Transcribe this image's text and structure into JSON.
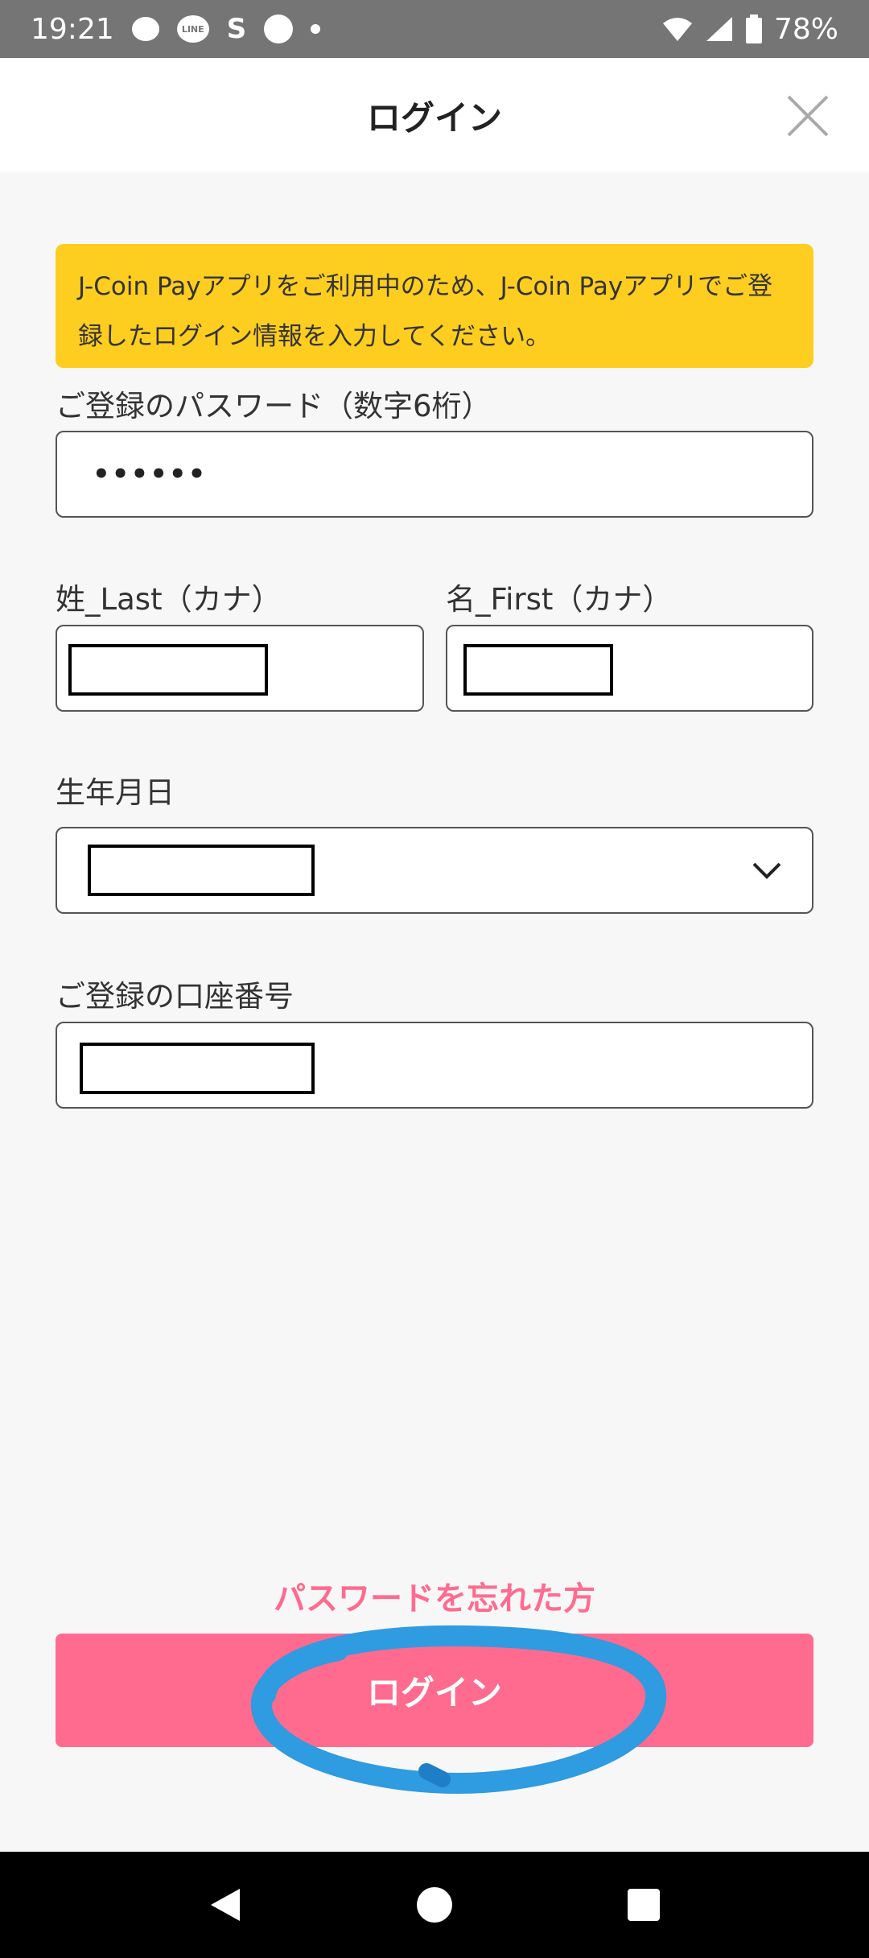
{
  "status_bar": {
    "time": "19:21",
    "battery": "78%",
    "line_label": "LINE",
    "icons": [
      "chat-bubble-icon",
      "line-icon",
      "s-icon",
      "m-icon",
      "dot-icon",
      "signal-icon",
      "battery-icon"
    ]
  },
  "header": {
    "title": "ログイン"
  },
  "notice": {
    "text": "J-Coin Payアプリをご利用中のため、J-Coin Payアプリでご登録したログイン情報を入力してください。"
  },
  "form": {
    "password": {
      "label": "ご登録のパスワード（数字6桁）",
      "value": "••••••"
    },
    "last_name": {
      "label": "姓_Last（カナ）"
    },
    "first_name": {
      "label": "名_First（カナ）"
    },
    "birthdate": {
      "label": "生年月日"
    },
    "account_number": {
      "label": "ご登録の口座番号"
    }
  },
  "forgot_password": "パスワードを忘れた方",
  "login_button": "ログイン",
  "colors": {
    "accent_pink": "#ff6b8f",
    "notice_yellow": "#fdcd20",
    "annotation_blue": "#2f9be0"
  }
}
